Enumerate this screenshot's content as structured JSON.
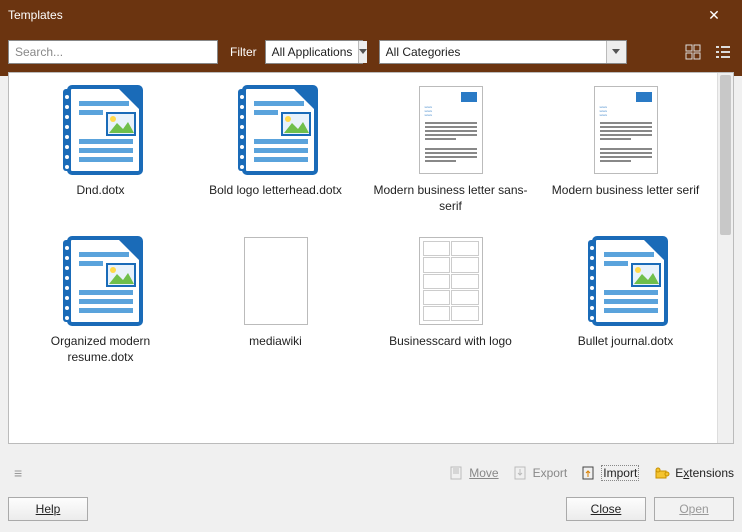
{
  "window": {
    "title": "Templates"
  },
  "filter": {
    "search_placeholder": "Search...",
    "label": "Filter",
    "app_combo": "All Applications",
    "cat_combo": "All Categories"
  },
  "templates": [
    {
      "name": "Dnd.dotx",
      "kind": "writer"
    },
    {
      "name": "Bold logo letterhead.dotx",
      "kind": "writer"
    },
    {
      "name": "Modern business letter sans-serif",
      "kind": "doc"
    },
    {
      "name": "Modern business letter serif",
      "kind": "doc"
    },
    {
      "name": "Organized modern resume.dotx",
      "kind": "writer"
    },
    {
      "name": "mediawiki",
      "kind": "blank"
    },
    {
      "name": "Businesscard with logo",
      "kind": "cards"
    },
    {
      "name": "Bullet journal.dotx",
      "kind": "writer"
    }
  ],
  "actions": {
    "move": "Move",
    "export": "Export",
    "import": "Import",
    "extensions": "Extensions"
  },
  "buttons": {
    "help": "Help",
    "close": "Close",
    "open": "Open"
  }
}
